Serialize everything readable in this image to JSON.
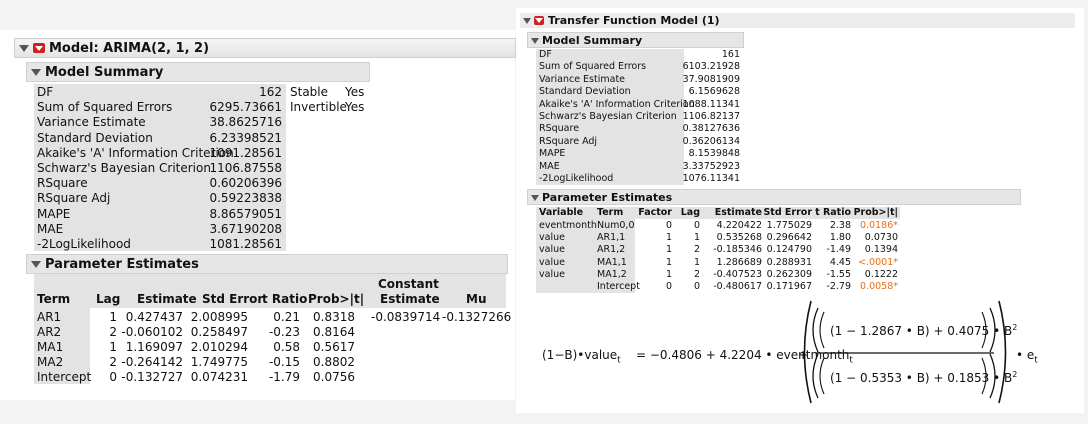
{
  "left": {
    "title": "Model: ARIMA(2, 1, 2)",
    "summary_title": "Model Summary",
    "summary_rows": [
      {
        "label": "DF",
        "value": "162"
      },
      {
        "label": "Sum of Squared Errors",
        "value": "6295.73661"
      },
      {
        "label": "Variance Estimate",
        "value": "38.8625716"
      },
      {
        "label": "Standard Deviation",
        "value": "6.23398521"
      },
      {
        "label": "Akaike's 'A' Information Criterion",
        "value": "1091.28561"
      },
      {
        "label": "Schwarz's Bayesian Criterion",
        "value": "1106.87558"
      },
      {
        "label": "RSquare",
        "value": "0.60206396"
      },
      {
        "label": "RSquare Adj",
        "value": "0.59223838"
      },
      {
        "label": "MAPE",
        "value": "8.86579051"
      },
      {
        "label": "MAE",
        "value": "3.67190208"
      },
      {
        "label": "-2LogLikelihood",
        "value": "1081.28561"
      }
    ],
    "flags": [
      {
        "label": "Stable",
        "value": "Yes"
      },
      {
        "label": "Invertible",
        "value": "Yes"
      }
    ],
    "pe_title": "Parameter Estimates",
    "pe_headers": [
      "Term",
      "Lag",
      "Estimate",
      "Std Error",
      "t Ratio",
      "Prob>|t|",
      "Constant",
      "Estimate",
      "Mu"
    ],
    "pe_rows": [
      [
        "AR1",
        "1",
        "0.427437",
        "2.008995",
        "0.21",
        "0.8318"
      ],
      [
        "AR2",
        "2",
        "-0.060102",
        "0.258497",
        "-0.23",
        "0.8164"
      ],
      [
        "MA1",
        "1",
        "1.169097",
        "2.010294",
        "0.58",
        "0.5617"
      ],
      [
        "MA2",
        "2",
        "-0.264142",
        "1.749775",
        "-0.15",
        "0.8802"
      ],
      [
        "Intercept",
        "0",
        "-0.132727",
        "0.074231",
        "-1.79",
        "0.0756"
      ]
    ],
    "constant_estimate": "-0.0839714",
    "mu": "-0.1327266"
  },
  "right": {
    "title": "Transfer Function Model (1)",
    "summary_title": "Model Summary",
    "summary_rows": [
      {
        "label": "DF",
        "value": "161"
      },
      {
        "label": "Sum of Squared Errors",
        "value": "6103.21928"
      },
      {
        "label": "Variance Estimate",
        "value": "37.9081909"
      },
      {
        "label": "Standard Deviation",
        "value": "6.1569628"
      },
      {
        "label": "Akaike's 'A' Information Criterion",
        "value": "1088.11341"
      },
      {
        "label": "Schwarz's Bayesian Criterion",
        "value": "1106.82137"
      },
      {
        "label": "RSquare",
        "value": "0.38127636"
      },
      {
        "label": "RSquare Adj",
        "value": "0.36206134"
      },
      {
        "label": "MAPE",
        "value": "8.1539848"
      },
      {
        "label": "MAE",
        "value": "3.33752923"
      },
      {
        "label": "-2LogLikelihood",
        "value": "1076.11341"
      }
    ],
    "pe_title": "Parameter Estimates",
    "pe_headers": [
      "Variable",
      "Term",
      "Factor",
      "Lag",
      "Estimate",
      "Std Error",
      "t Ratio",
      "Prob>|t|"
    ],
    "pe_rows": [
      [
        "eventmonth",
        "Num0,0",
        "0",
        "0",
        "4.220422",
        "1.775029",
        "2.38",
        "0.0186*"
      ],
      [
        "value",
        "AR1,1",
        "1",
        "1",
        "0.535268",
        "0.296642",
        "1.80",
        "0.0730"
      ],
      [
        "value",
        "AR1,2",
        "1",
        "2",
        "-0.185346",
        "0.124790",
        "-1.49",
        "0.1394"
      ],
      [
        "value",
        "MA1,1",
        "1",
        "1",
        "1.286689",
        "0.288931",
        "4.45",
        "<.0001*"
      ],
      [
        "value",
        "MA1,2",
        "1",
        "2",
        "-0.407523",
        "0.262309",
        "-1.55",
        "0.1222"
      ],
      [
        "",
        "Intercept",
        "0",
        "0",
        "-0.480617",
        "0.171967",
        "-2.79",
        "0.0058*"
      ]
    ],
    "equation": {
      "lhs": "(1−B)•value",
      "lhs_sub": "t",
      "rhs1": "= −0.4806 + 4.2204 • eventmonth",
      "rhs1_sub": "t",
      "plus": "+",
      "num": "(1 − 1.2867 • B) + 0.4075 • B",
      "den": "(1 − 0.5353 • B) + 0.1853 • B",
      "sup": "2",
      "tail": "• e",
      "tail_sub": "t"
    }
  },
  "colors": {
    "highlight": "#e8701a",
    "red_button": "#d21f1f",
    "header_bg": "#e6e6e6",
    "shade": "#e3e3e3"
  }
}
